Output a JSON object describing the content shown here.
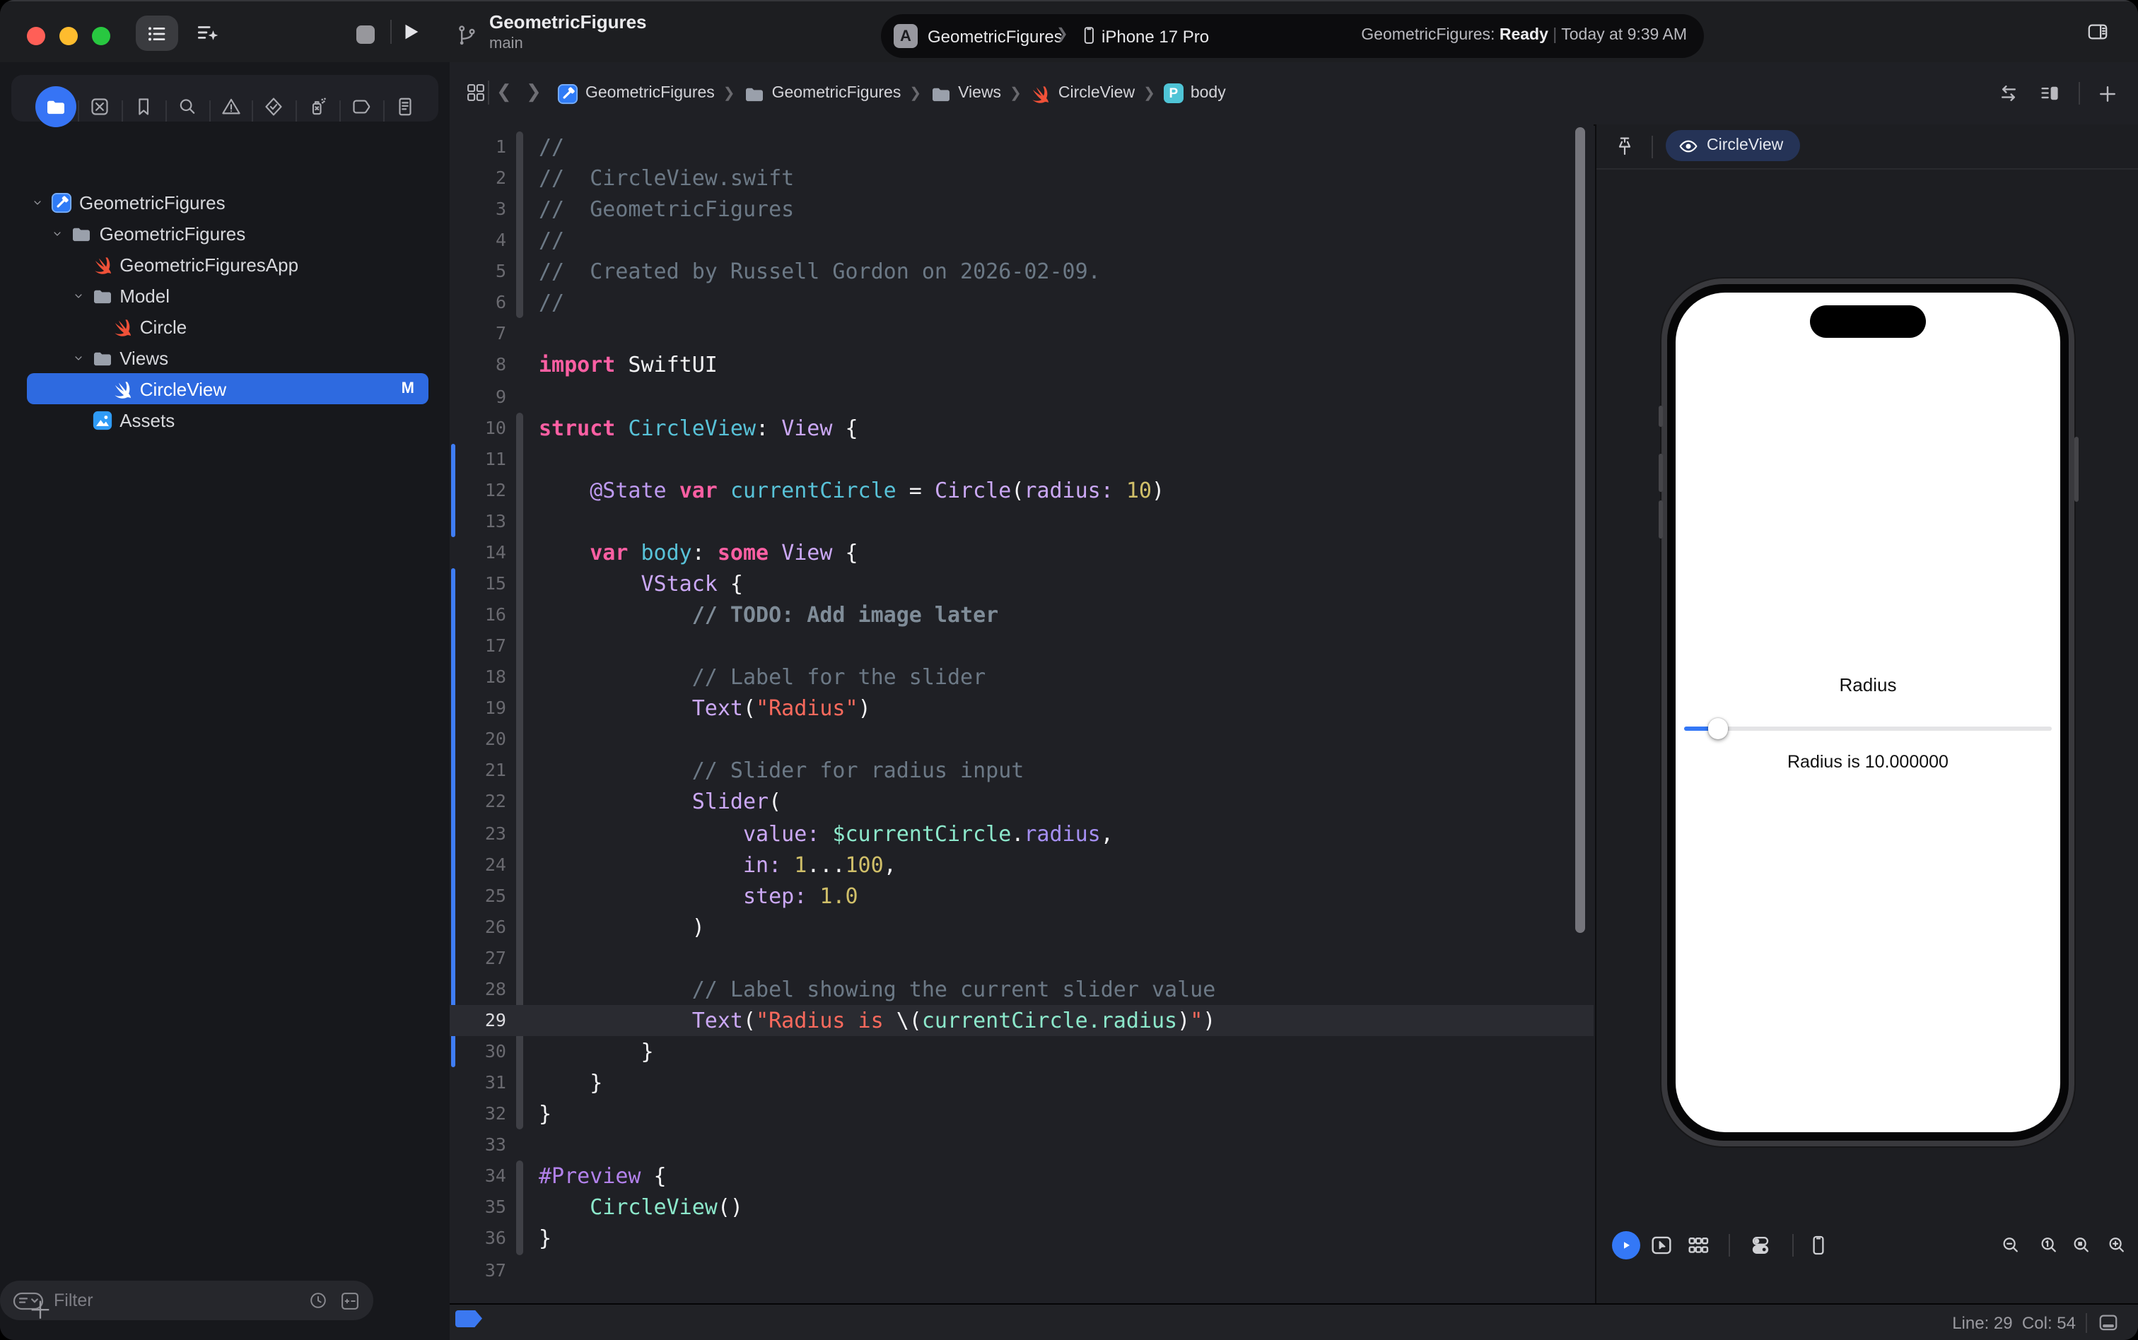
{
  "titlebar": {
    "project": "GeometricFigures",
    "branch": "main",
    "scheme": "GeometricFigures",
    "destination": "iPhone 17 Pro",
    "status_project": "GeometricFigures: ",
    "status_state": "Ready",
    "status_sep": " | ",
    "status_time": "Today at 9:39 AM"
  },
  "navigator": {
    "tabs": [
      {
        "name": "project-navigator",
        "icon": "folder",
        "selected": true
      },
      {
        "name": "source-control-navigator",
        "icon": "squarex"
      },
      {
        "name": "bookmark-navigator",
        "icon": "bookmark"
      },
      {
        "name": "find-navigator",
        "icon": "search"
      },
      {
        "name": "issue-navigator",
        "icon": "warning"
      },
      {
        "name": "test-navigator",
        "icon": "testdiamond"
      },
      {
        "name": "debug-navigator",
        "icon": "spray"
      },
      {
        "name": "breakpoint-navigator",
        "icon": "tag"
      },
      {
        "name": "report-navigator",
        "icon": "report"
      }
    ],
    "tree": [
      {
        "depth": 0,
        "chevron": true,
        "icon": "xcodeproj",
        "label": "GeometricFigures"
      },
      {
        "depth": 1,
        "chevron": true,
        "icon": "folder",
        "label": "GeometricFigures"
      },
      {
        "depth": 2,
        "chevron": false,
        "icon": "swift",
        "label": "GeometricFiguresApp"
      },
      {
        "depth": 2,
        "chevron": true,
        "icon": "folder",
        "label": "Model"
      },
      {
        "depth": 3,
        "chevron": false,
        "icon": "swift",
        "label": "Circle"
      },
      {
        "depth": 2,
        "chevron": true,
        "icon": "folder",
        "label": "Views"
      },
      {
        "depth": 3,
        "chevron": false,
        "icon": "swift",
        "label": "CircleView",
        "selected": true,
        "badge": "M"
      },
      {
        "depth": 2,
        "chevron": false,
        "icon": "assets",
        "label": "Assets"
      }
    ],
    "filter_placeholder": "Filter"
  },
  "jumpbar": {
    "crumbs": [
      {
        "icon": "xcodeproj",
        "label": "GeometricFigures"
      },
      {
        "icon": "folder",
        "label": "GeometricFigures"
      },
      {
        "icon": "folder",
        "label": "Views"
      },
      {
        "icon": "swift",
        "label": "CircleView"
      },
      {
        "icon": "property",
        "label": "body"
      }
    ]
  },
  "editor": {
    "current_line": 29,
    "change_bars": [
      [
        11,
        13
      ],
      [
        15,
        30
      ]
    ],
    "fold_segments": [
      [
        1,
        6
      ],
      [
        10,
        32
      ],
      [
        34,
        36
      ]
    ],
    "lines": [
      [
        1,
        [
          [
            "c",
            "//"
          ]
        ]
      ],
      [
        2,
        [
          [
            "c",
            "//  CircleView.swift"
          ]
        ]
      ],
      [
        3,
        [
          [
            "c",
            "//  GeometricFigures"
          ]
        ]
      ],
      [
        4,
        [
          [
            "c",
            "//"
          ]
        ]
      ],
      [
        5,
        [
          [
            "c",
            "//  Created by Russell Gordon on 2026-02-09."
          ]
        ]
      ],
      [
        6,
        [
          [
            "c",
            "//"
          ]
        ]
      ],
      [
        7,
        []
      ],
      [
        8,
        [
          [
            "k",
            "import"
          ],
          [
            "w",
            " SwiftUI"
          ]
        ]
      ],
      [
        9,
        []
      ],
      [
        10,
        [
          [
            "k",
            "struct"
          ],
          [
            "w",
            " "
          ],
          [
            "d",
            "CircleView"
          ],
          [
            "w",
            ": "
          ],
          [
            "t",
            "View"
          ],
          [
            "w",
            " {"
          ]
        ]
      ],
      [
        11,
        []
      ],
      [
        12,
        [
          [
            "w",
            "    "
          ],
          [
            "at",
            "@State"
          ],
          [
            "w",
            " "
          ],
          [
            "k",
            "var"
          ],
          [
            "w",
            " "
          ],
          [
            "d",
            "currentCircle"
          ],
          [
            "w",
            " = "
          ],
          [
            "t",
            "Circle"
          ],
          [
            "w",
            "("
          ],
          [
            "t",
            "radius:"
          ],
          [
            "w",
            " "
          ],
          [
            "n",
            "10"
          ],
          [
            "w",
            ")"
          ]
        ]
      ],
      [
        13,
        []
      ],
      [
        14,
        [
          [
            "w",
            "    "
          ],
          [
            "k",
            "var"
          ],
          [
            "w",
            " "
          ],
          [
            "d",
            "body"
          ],
          [
            "w",
            ": "
          ],
          [
            "k",
            "some"
          ],
          [
            "w",
            " "
          ],
          [
            "t",
            "View"
          ],
          [
            "w",
            " {"
          ]
        ]
      ],
      [
        15,
        [
          [
            "w",
            "        "
          ],
          [
            "t",
            "VStack"
          ],
          [
            "w",
            " {"
          ]
        ]
      ],
      [
        16,
        [
          [
            "cb",
            "            // TODO: Add image later"
          ]
        ]
      ],
      [
        17,
        []
      ],
      [
        18,
        [
          [
            "c",
            "            // Label for the slider"
          ]
        ]
      ],
      [
        19,
        [
          [
            "w",
            "            "
          ],
          [
            "t",
            "Text"
          ],
          [
            "w",
            "("
          ],
          [
            "s",
            "\"Radius\""
          ],
          [
            "w",
            ")"
          ]
        ]
      ],
      [
        20,
        []
      ],
      [
        21,
        [
          [
            "c",
            "            // Slider for radius input"
          ]
        ]
      ],
      [
        22,
        [
          [
            "w",
            "            "
          ],
          [
            "t",
            "Slider"
          ],
          [
            "w",
            "("
          ]
        ]
      ],
      [
        23,
        [
          [
            "w",
            "                "
          ],
          [
            "t",
            "value:"
          ],
          [
            "w",
            " "
          ],
          [
            "m",
            "$currentCircle"
          ],
          [
            "w",
            "."
          ],
          [
            "p",
            "radius"
          ],
          [
            "w",
            ","
          ]
        ]
      ],
      [
        24,
        [
          [
            "w",
            "                "
          ],
          [
            "t",
            "in:"
          ],
          [
            "w",
            " "
          ],
          [
            "n",
            "1"
          ],
          [
            "w",
            "..."
          ],
          [
            "n",
            "100"
          ],
          [
            "w",
            ","
          ]
        ]
      ],
      [
        25,
        [
          [
            "w",
            "                "
          ],
          [
            "t",
            "step:"
          ],
          [
            "w",
            " "
          ],
          [
            "n",
            "1.0"
          ]
        ]
      ],
      [
        26,
        [
          [
            "w",
            "            )"
          ]
        ]
      ],
      [
        27,
        []
      ],
      [
        28,
        [
          [
            "c",
            "            // Label showing the current slider value"
          ]
        ]
      ],
      [
        29,
        [
          [
            "w",
            "            "
          ],
          [
            "t",
            "Text"
          ],
          [
            "w",
            "("
          ],
          [
            "s",
            "\"Radius is "
          ],
          [
            "w",
            "\\("
          ],
          [
            "m",
            "currentCircle.radius"
          ],
          [
            "w",
            ")"
          ],
          [
            "s",
            "\""
          ],
          [
            "w",
            ")"
          ]
        ]
      ],
      [
        30,
        [
          [
            "w",
            "        }"
          ]
        ]
      ],
      [
        31,
        [
          [
            "w",
            "    }"
          ]
        ]
      ],
      [
        32,
        [
          [
            "w",
            "}"
          ]
        ]
      ],
      [
        33,
        []
      ],
      [
        34,
        [
          [
            "mac",
            "#Preview"
          ],
          [
            "w",
            " {"
          ]
        ]
      ],
      [
        35,
        [
          [
            "w",
            "    "
          ],
          [
            "m",
            "CircleView"
          ],
          [
            "w",
            "()"
          ]
        ]
      ],
      [
        36,
        [
          [
            "w",
            "}"
          ]
        ]
      ],
      [
        37,
        []
      ]
    ]
  },
  "canvas": {
    "preview_pill": "CircleView",
    "phone": {
      "label": "Radius",
      "value_label": "Radius is 10.000000",
      "slider": {
        "min": 1,
        "max": 100,
        "value": 10
      }
    },
    "toolbar_left": [
      "live-preview",
      "selectable-mode",
      "variants",
      "device-settings",
      "device"
    ],
    "toolbar_right": [
      "zoom-out",
      "zoom-100",
      "zoom-fit",
      "zoom-in"
    ]
  },
  "statusbar": {
    "line_col": "Line: 29  Col: 54"
  },
  "colors": {
    "accent": "#3478f6",
    "selection": "#2e6ae0",
    "swift_orange": "#f05138",
    "change_bar": "#3f7df5"
  }
}
